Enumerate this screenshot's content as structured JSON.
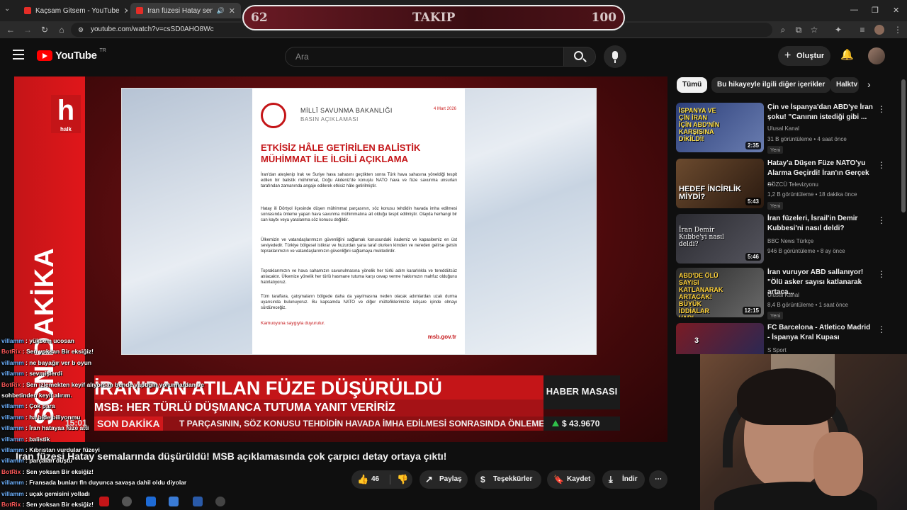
{
  "browser": {
    "tabs": [
      {
        "title": "Kaçsam Gitsem - YouTube",
        "active": false
      },
      {
        "title": "İran füzesi Hatay semalarında",
        "active": true
      }
    ],
    "url": "youtube.com/watch?v=csSD0AHO8Wc"
  },
  "overlay": {
    "follow_left": "62",
    "follow_label": "TAKIP",
    "follow_right": "100"
  },
  "youtube": {
    "logo": "YouTube",
    "region": "TR",
    "search_placeholder": "Ara",
    "create_label": "Oluştur"
  },
  "video": {
    "channel_logo": "h",
    "channel_name": "halk",
    "side_label": "SON DAKİKA",
    "doc": {
      "ministry": "MİLLÎ SAVUNMA BAKANLIĞI",
      "press": "BASIN AÇIKLAMASI",
      "date": "4 Mart 2026",
      "title": "ETKİSİZ HÂLE GETİRİLEN BALİSTİK MÜHİMMAT İLE İLGİLİ AÇIKLAMA",
      "paragraphs": [
        "İran'dan ateşlenip Irak ve Suriye hava sahasını geçtikten sonra Türk hava sahasına yöneldiği tespit edilen bir balistik mühimmat, Doğu Akdeniz'de konuşlu NATO hava ve füze savunma unsurları tarafından zamanında angaje edilerek etkisiz hâle getirilmiştir.",
        "Hatay ili Dörtyol ilçesinde düşen mühimmat parçasının, söz konusu tehdidin havada imha edilmesi sonrasında önleme yapan hava savunma mühimmatına ait olduğu tespit edilmiştir. Olayda herhangi bir can kaybı veya yaralanma söz konusu değildir.",
        "Ülkemizin ve vatandaşlarımızın güvenliğini sağlamak konusundaki irademiz ve kapasitemiz en üst seviyededir. Türkiye bölgesel istikrar ve huzurdan yana taraf olurken kimden ve nereden gelirse gelsin topraklarımızın ve vatandaşlarımızın güvenliğini sağlamaya muktedirdir.",
        "Topraklarımızın ve hava sahamızın savunulmasına yönelik her türlü adım kararlılıkla ve tereddütsüz atılacaktır. Ülkemize yönelik her türlü hasmane tutuma karşı cevap verme hakkımızın mahfuz olduğunu hatırlatıyoruz.",
        "Tüm taraflara, çatışmaların bölgede daha da yayılmasına neden olacak adımlardan uzak durma uyarısında bulunuyoruz. Bu kapsamda NATO ve diğer müttefiklerimizle istişare içinde olmayı sürdüreceğiz."
      ],
      "closing": "Kamuoyuna saygıyla duyurulur.",
      "website": "msb.gov.tr"
    },
    "headline": "İRAN'DAN ATILAN FÜZE DÜŞÜRÜLDÜ",
    "subheadline": "MSB: HER TÜRLÜ DÜŞMANCA TUTUMA YANIT VERİRİZ",
    "ticker_label": "SON DAKİKA",
    "ticker_text": "T PARÇASININ, SÖZ KONUSU TEHDİDİN HAVADA İMHA EDİLMESİ SONRASINDA ÖNLEME",
    "program": "HABER MASASI",
    "dollar": "$ 43.9670",
    "time_overlay": "15:01",
    "title": "İran füzesi Hatay semalarında düşürüldü! MSB açıklamasında çok çarpıcı detay ortaya çıktı!"
  },
  "actions": {
    "likes": "46",
    "share": "Paylaş",
    "thanks": "Teşekkürler",
    "save": "Kaydet",
    "download": "İndir"
  },
  "chips": [
    "Tümü",
    "Bu hikayeyle ilgili diğer içerikler",
    "Halktv"
  ],
  "recommendations": [
    {
      "title": "Çin ve İspanya'dan ABD'ye İran şoku! \"Canının istediği gibi ...",
      "channel": "Ulusal Kanal",
      "meta": "31 B görüntüleme • 4 saat önce",
      "badge": "Yeni",
      "duration": "2:35",
      "caption": "İSPANYA VE ÇİN İRAN İÇİN ABD'NİN KARŞISINA DİKİLDİ!",
      "thumb": "#2c3f7a"
    },
    {
      "title": "Hatay'a Düşen Füze NATO'yu Alarma Geçirdi! İran'ın Gerçek ...",
      "channel": "SÖZCÜ Televizyonu",
      "meta": "1,2 B görüntüleme • 18 dakika önce",
      "badge": "Yeni",
      "duration": "5:43",
      "caption": "HEDEF İNCİRLİK MİYDİ?",
      "thumb": "#6b4a2e"
    },
    {
      "title": "İran füzeleri, İsrail'in Demir Kubbesi'ni nasıl deldi?",
      "channel": "BBC News Türkçe",
      "meta": "946 B görüntüleme • 8 ay önce",
      "badge": "",
      "duration": "5:46",
      "caption": "İran Demir Kubbe'yi nasıl deldi?",
      "thumb": "#2a2a30"
    },
    {
      "title": "İran vuruyor ABD sallanıyor! \"Ölü asker sayısı katlanarak artaca...",
      "channel": "Ulusal Kanal",
      "meta": "8,4 B görüntüleme • 1 saat önce",
      "badge": "Yeni",
      "duration": "12:15",
      "caption": "ABD'DE ÖLÜ SAYISI KATLANARAK ARTACAK! BÜYÜK İDDİALAR VAR!",
      "thumb": "#3a3a3a"
    },
    {
      "title": "FC Barcelona - Atletico Madrid - İspanya Kral Kupası",
      "channel": "S Sport",
      "meta": "",
      "badge": "",
      "duration": "",
      "caption": "3",
      "thumb": "#7a1b24"
    }
  ],
  "chat": [
    {
      "user": "villamm",
      "msg": "yüksem ucosan",
      "bot": false
    },
    {
      "user": "BotRix",
      "msg": "Sen yoksan Bir eksiğiz!",
      "bot": true
    },
    {
      "user": "villamm",
      "msg": "ne bayağır ver b oyun",
      "bot": false
    },
    {
      "user": "villamm",
      "msg": "sevmişlerdi",
      "bot": false
    },
    {
      "user": "BotRix",
      "msg": "Sen izlemekten keyif alıyorsan bende yaptığın yorumlardan ve",
      "bot": true
    },
    {
      "user": "",
      "msg": "sohbetinden keyif alırım.",
      "bot": false
    },
    {
      "user": "villamm",
      "msg": "Çok para",
      "bot": false
    },
    {
      "user": "villamm",
      "msg": "ha bide biliyonmu",
      "bot": false
    },
    {
      "user": "villamm",
      "msg": "İran hatayaa füze atti",
      "bot": false
    },
    {
      "user": "villamm",
      "msg": "balistik",
      "bot": false
    },
    {
      "user": "villamm",
      "msg": "Kıbrıstan vurdular füzeyi",
      "bot": false
    },
    {
      "user": "villamm",
      "msg": "parçaları düştü",
      "bot": false
    },
    {
      "user": "BotRix",
      "msg": "Sen yoksan Bir eksiğiz!",
      "bot": true
    },
    {
      "user": "villamm",
      "msg": "Fransada bunları fln duyunca savaşa dahil oldu diyolar",
      "bot": false
    },
    {
      "user": "villamm",
      "msg": "uçak gemisini yolladı",
      "bot": false
    },
    {
      "user": "BotRix",
      "msg": "Sen yoksan Bir eksiğiz!",
      "bot": true
    }
  ],
  "colors": {
    "accent": "#c41518",
    "background": "#0f0f0f",
    "surface": "#272727"
  }
}
